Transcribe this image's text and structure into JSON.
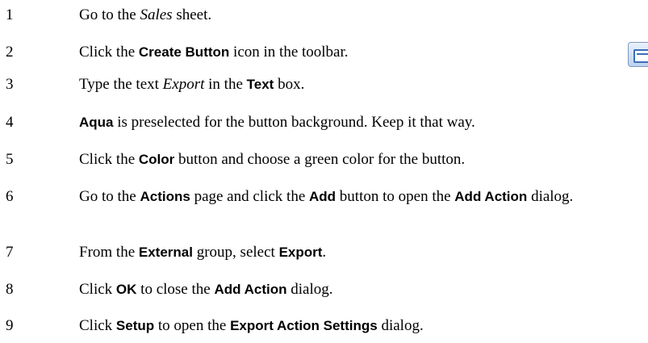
{
  "steps": [
    {
      "number": "1",
      "parts": [
        {
          "t": "Go to the "
        },
        {
          "t": "Sales",
          "s": "i"
        },
        {
          "t": " sheet."
        }
      ]
    },
    {
      "number": "2",
      "parts": [
        {
          "t": "Click the "
        },
        {
          "t": "Create Button",
          "s": "b"
        },
        {
          "t": " icon in the toolbar."
        }
      ]
    },
    {
      "number": "3",
      "parts": [
        {
          "t": "Type the text "
        },
        {
          "t": "Export",
          "s": "i"
        },
        {
          "t": " in the "
        },
        {
          "t": "Text",
          "s": "b"
        },
        {
          "t": " box."
        }
      ]
    },
    {
      "number": "4",
      "parts": [
        {
          "t": "Aqua",
          "s": "b"
        },
        {
          "t": " is preselected for the button background. Keep it that way."
        }
      ]
    },
    {
      "number": "5",
      "parts": [
        {
          "t": "Click the "
        },
        {
          "t": "Color",
          "s": "b"
        },
        {
          "t": " button and choose a green color for the button."
        }
      ]
    },
    {
      "number": "6",
      "parts": [
        {
          "t": "Go to the "
        },
        {
          "t": "Actions",
          "s": "b"
        },
        {
          "t": " page and click the "
        },
        {
          "t": "Add",
          "s": "b"
        },
        {
          "t": " button to open the "
        },
        {
          "t": "Add Action",
          "s": "b"
        },
        {
          "t": " dialog."
        }
      ]
    },
    {
      "number": "7",
      "parts": [
        {
          "t": "From the "
        },
        {
          "t": "External",
          "s": "b"
        },
        {
          "t": " group, select "
        },
        {
          "t": "Export",
          "s": "b"
        },
        {
          "t": "."
        }
      ]
    },
    {
      "number": "8",
      "parts": [
        {
          "t": "Click "
        },
        {
          "t": "OK",
          "s": "b"
        },
        {
          "t": " to close the "
        },
        {
          "t": "Add Action",
          "s": "b"
        },
        {
          "t": " dialog."
        }
      ]
    },
    {
      "number": "9",
      "parts": [
        {
          "t": "Click "
        },
        {
          "t": "Setup",
          "s": "b"
        },
        {
          "t": " to open the "
        },
        {
          "t": "Export Action Settings",
          "s": "b"
        },
        {
          "t": " dialog."
        }
      ]
    }
  ],
  "toolbar_icon": {
    "name": "create-button-icon"
  }
}
